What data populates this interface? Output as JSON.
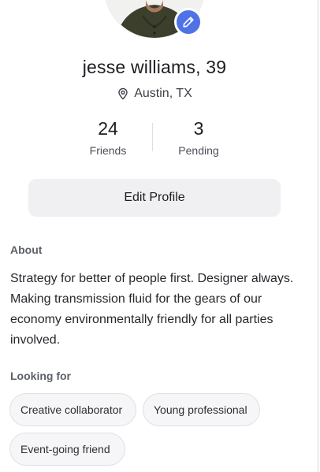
{
  "profile": {
    "name": "jesse williams, 39",
    "location": "Austin, TX"
  },
  "stats": {
    "friends": {
      "count": "24",
      "label": "Friends"
    },
    "pending": {
      "count": "3",
      "label": "Pending"
    }
  },
  "actions": {
    "edit_profile_label": "Edit Profile"
  },
  "about": {
    "title": "About",
    "text": "Strategy for better of people first. Designer always. Making transmission fluid for the gears of our economy environmentally friendly for all parties involved."
  },
  "looking_for": {
    "title": "Looking for",
    "chips": [
      "Creative collaborator",
      "Young professional",
      "Event-going friend"
    ]
  },
  "colors": {
    "accent": "#4f73e6",
    "button_bg": "#f0f0f3",
    "chip_bg": "#f6f6f8"
  },
  "icons": {
    "avatar_edit": "pencil-icon",
    "location": "map-pin-icon"
  }
}
